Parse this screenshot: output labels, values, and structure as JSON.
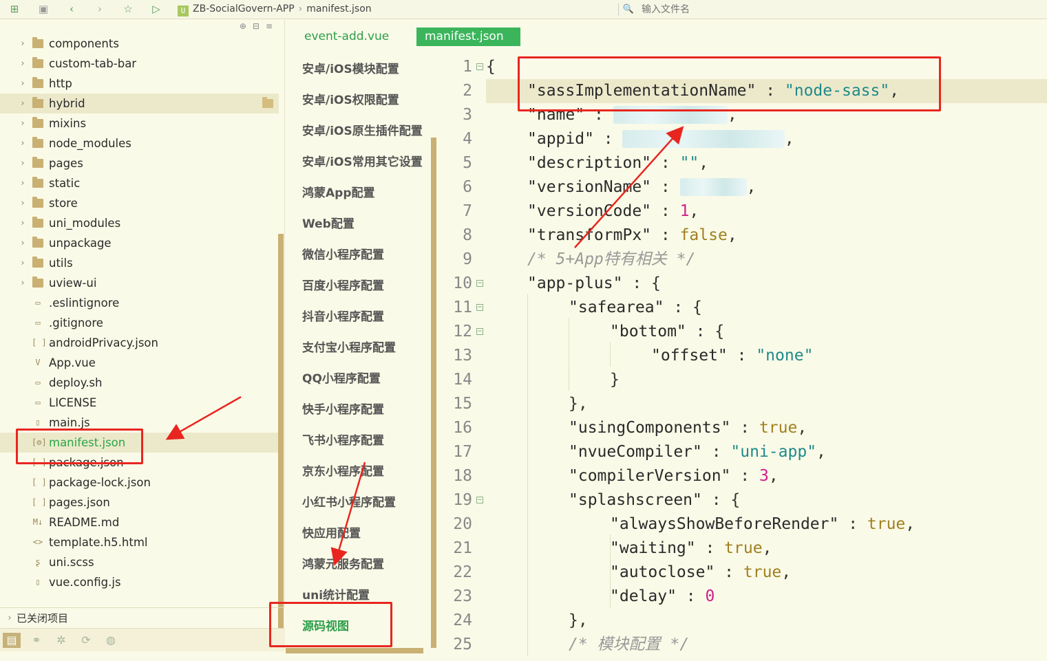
{
  "toolbar": {
    "breadcrumb_project": "ZB-SocialGovern-APP",
    "breadcrumb_file": "manifest.json",
    "file_search_placeholder": "输入文件名"
  },
  "tree": {
    "items": [
      {
        "label": "components",
        "kind": "folder"
      },
      {
        "label": "custom-tab-bar",
        "kind": "folder"
      },
      {
        "label": "http",
        "kind": "folder"
      },
      {
        "label": "hybrid",
        "kind": "folder"
      },
      {
        "label": "mixins",
        "kind": "folder"
      },
      {
        "label": "node_modules",
        "kind": "folder"
      },
      {
        "label": "pages",
        "kind": "folder"
      },
      {
        "label": "static",
        "kind": "folder"
      },
      {
        "label": "store",
        "kind": "folder"
      },
      {
        "label": "uni_modules",
        "kind": "folder"
      },
      {
        "label": "unpackage",
        "kind": "folder"
      },
      {
        "label": "utils",
        "kind": "folder"
      },
      {
        "label": "uview-ui",
        "kind": "folder"
      },
      {
        "label": ".eslintignore",
        "kind": "file"
      },
      {
        "label": ".gitignore",
        "kind": "file"
      },
      {
        "label": "androidPrivacy.json",
        "kind": "json"
      },
      {
        "label": "App.vue",
        "kind": "vue"
      },
      {
        "label": "deploy.sh",
        "kind": "file"
      },
      {
        "label": "LICENSE",
        "kind": "file"
      },
      {
        "label": "main.js",
        "kind": "js"
      },
      {
        "label": "manifest.json",
        "kind": "manifest"
      },
      {
        "label": "package.json",
        "kind": "json"
      },
      {
        "label": "package-lock.json",
        "kind": "json"
      },
      {
        "label": "pages.json",
        "kind": "json"
      },
      {
        "label": "README.md",
        "kind": "md"
      },
      {
        "label": "template.h5.html",
        "kind": "html"
      },
      {
        "label": "uni.scss",
        "kind": "scss"
      },
      {
        "label": "vue.config.js",
        "kind": "js"
      }
    ],
    "closed_projects": "已关闭项目"
  },
  "tabs": [
    {
      "label": "event-add.vue",
      "active": false
    },
    {
      "label": "manifest.json",
      "active": true
    }
  ],
  "config_menu": [
    "安卓/iOS模块配置",
    "安卓/iOS权限配置",
    "安卓/iOS原生插件配置",
    "安卓/iOS常用其它设置",
    "鸿蒙App配置",
    "Web配置",
    "微信小程序配置",
    "百度小程序配置",
    "抖音小程序配置",
    "支付宝小程序配置",
    "QQ小程序配置",
    "快手小程序配置",
    "飞书小程序配置",
    "京东小程序配置",
    "小红书小程序配置",
    "快应用配置",
    "鸿蒙元服务配置",
    "uni统计配置",
    "源码视图"
  ],
  "code": {
    "line_numbers": [
      "1",
      "2",
      "3",
      "4",
      "5",
      "6",
      "7",
      "8",
      "9",
      "10",
      "11",
      "12",
      "13",
      "14",
      "15",
      "16",
      "17",
      "18",
      "19",
      "20",
      "21",
      "22",
      "23",
      "24",
      "25"
    ],
    "keys": {
      "sass": "\"sassImplementationName\"",
      "name": "\"name\"",
      "appid": "\"appid\"",
      "description": "\"description\"",
      "versionName": "\"versionName\"",
      "versionCode": "\"versionCode\"",
      "transformPx": "\"transformPx\"",
      "appPlus": "\"app-plus\"",
      "safearea": "\"safearea\"",
      "bottom": "\"bottom\"",
      "offset": "\"offset\"",
      "usingComponents": "\"usingComponents\"",
      "nvueCompiler": "\"nvueCompiler\"",
      "compilerVersion": "\"compilerVersion\"",
      "splashscreen": "\"splashscreen\"",
      "alwaysShowBeforeRender": "\"alwaysShowBeforeRender\"",
      "waiting": "\"waiting\"",
      "autoclose": "\"autoclose\"",
      "delay": "\"delay\""
    },
    "values": {
      "sass": "\"node-sass\"",
      "description": "\"\"",
      "versionCode": "1",
      "transformPx": "false",
      "offset": "\"none\"",
      "usingComponents": "true",
      "nvueCompiler": "\"uni-app\"",
      "compilerVersion": "3",
      "alwaysShowBeforeRender": "true",
      "waiting": "true",
      "autoclose": "true",
      "delay": "0"
    },
    "comments": {
      "app_specific": "/* 5+App特有相关 */",
      "module_config": "/* 模块配置 */"
    }
  },
  "colors": {
    "annotation_red": "#e8261f",
    "accent_green": "#3bb55b",
    "folder_gold": "#c9b073"
  }
}
